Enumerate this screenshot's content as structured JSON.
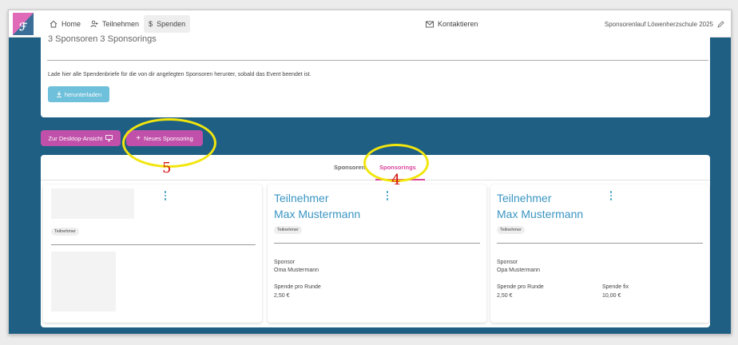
{
  "nav": {
    "home": "Home",
    "teilnehmen": "Teilnehmen",
    "spenden": "Spenden",
    "kontakt": "Kontaktieren",
    "event_name": "Sponsorenlauf Löwenherzschule 2025"
  },
  "summary": {
    "count_text": "3 Sponsoren 3 Sponsorings",
    "info_text": "Lade hier alle Spendenbriefe für die von dir angelegten Sponsoren herunter, sobald das Event beendet ist.",
    "download_label": "herunterladen"
  },
  "actions": {
    "desktop_label": "Zur Desktop-Ansicht",
    "new_label": "Neues Sponsoring"
  },
  "tabs": {
    "sponsoren": "Sponsoren",
    "sponsorings": "Sponsorings",
    "active": "sponsorings"
  },
  "cards": [
    {
      "chip": "Teilnehmer",
      "loading": true
    },
    {
      "title": "Teilnehmer",
      "name": "Max Mustermann",
      "chip": "Teilnehmer",
      "sponsor_label": "Sponsor",
      "sponsor": "Oma Mustermann",
      "per_round_label": "Spende pro Runde",
      "per_round": "2,50 €"
    },
    {
      "title": "Teilnehmer",
      "name": "Max Mustermann",
      "chip": "Teilnehmer",
      "sponsor_label": "Sponsor",
      "sponsor": "Opa Mustermann",
      "per_round_label": "Spende pro Runde",
      "per_round": "2,50 €",
      "fix_label": "Spende fix",
      "fix": "10,00 €"
    }
  ],
  "annotations": {
    "new_sponsoring_marker": "5",
    "sponsorings_tab_marker": "4"
  },
  "colors": {
    "primary_blue": "#1f5f84",
    "accent_pink": "#c050a9",
    "tab_pink": "#d9489d",
    "link_blue": "#3a95c2",
    "highlight_yellow": "#f2e60d",
    "marker_red": "#d41010"
  }
}
